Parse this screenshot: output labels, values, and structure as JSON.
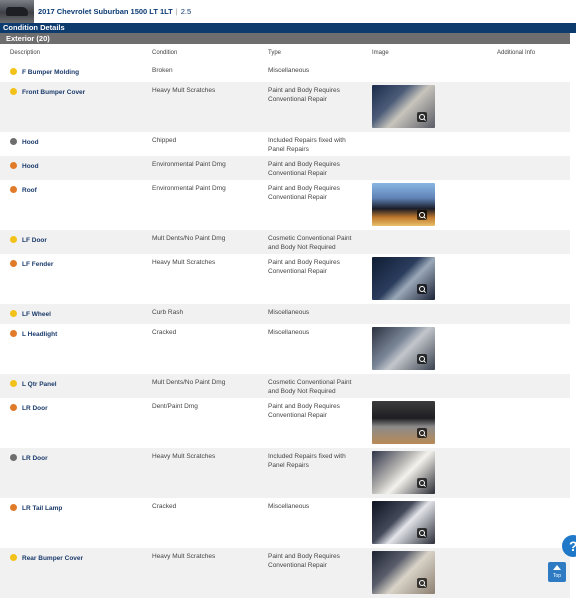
{
  "vehicle": {
    "title": "2017 Chevrolet Suburban 1500 LT 1LT",
    "separator": "|",
    "grade": "2.5"
  },
  "condition_details": {
    "title": "Condition Details"
  },
  "exterior": {
    "title": "Exterior (20)"
  },
  "columns": {
    "description": "Description",
    "condition": "Condition",
    "type": "Type",
    "image": "Image",
    "additional_info": "Additional Info"
  },
  "colors": {
    "yellow": "#f2c21a",
    "orange": "#e07b2a",
    "gray": "#6d6d6d",
    "header_blue": "#0d3b6e",
    "link_blue": "#1a3a6b"
  },
  "damages": [
    {
      "description": "F Bumper Molding",
      "condition": "Broken",
      "type": "Miscellaneous",
      "severity": "yellow",
      "has_image": false
    },
    {
      "description": "Front Bumper Cover",
      "condition": "Heavy Mult Scratches",
      "type": "Paint and Body Requires Conventional Repair",
      "severity": "yellow",
      "has_image": true
    },
    {
      "description": "Hood",
      "condition": "Chipped",
      "type": "Included Repairs fixed with Panel Repairs",
      "severity": "gray",
      "has_image": false
    },
    {
      "description": "Hood",
      "condition": "Environmental Paint Dmg",
      "type": "Paint and Body Requires Conventional Repair",
      "severity": "orange",
      "has_image": false
    },
    {
      "description": "Roof",
      "condition": "Environmental Paint Dmg",
      "type": "Paint and Body Requires Conventional Repair",
      "severity": "orange",
      "has_image": true
    },
    {
      "description": "LF Door",
      "condition": "Mult Dents/No Paint Dmg",
      "type": "Cosmetic Conventional Paint and Body Not Required",
      "severity": "yellow",
      "has_image": false
    },
    {
      "description": "LF Fender",
      "condition": "Heavy Mult Scratches",
      "type": "Paint and Body Requires Conventional Repair",
      "severity": "orange",
      "has_image": true
    },
    {
      "description": "LF Wheel",
      "condition": "Curb Rash",
      "type": "Miscellaneous",
      "severity": "yellow",
      "has_image": false
    },
    {
      "description": "L Headlight",
      "condition": "Cracked",
      "type": "Miscellaneous",
      "severity": "orange",
      "has_image": true
    },
    {
      "description": "L Qtr Panel",
      "condition": "Mult Dents/No Paint Dmg",
      "type": "Cosmetic Conventional Paint and Body Not Required",
      "severity": "yellow",
      "has_image": false
    },
    {
      "description": "LR Door",
      "condition": "Dent/Paint Dmg",
      "type": "Paint and Body Requires Conventional Repair",
      "severity": "orange",
      "has_image": true
    },
    {
      "description": "LR Door",
      "condition": "Heavy Mult Scratches",
      "type": "Included Repairs fixed with Panel Repairs",
      "severity": "gray",
      "has_image": true
    },
    {
      "description": "LR Tail Lamp",
      "condition": "Cracked",
      "type": "Miscellaneous",
      "severity": "orange",
      "has_image": true
    },
    {
      "description": "Rear Bumper Cover",
      "condition": "Heavy Mult Scratches",
      "type": "Paint and Body Requires Conventional Repair",
      "severity": "yellow",
      "has_image": true
    }
  ],
  "help_button": {
    "label": "?"
  },
  "top_button": {
    "label": "Top"
  }
}
